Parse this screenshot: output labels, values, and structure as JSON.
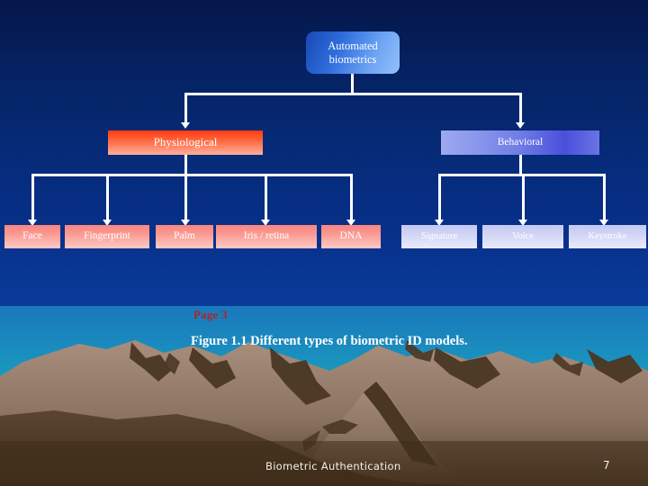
{
  "slide": {
    "root": {
      "label": "Automated\nbiometrics"
    },
    "categories": [
      {
        "label": "Physiological",
        "color": "#ff5a2e"
      },
      {
        "label": "Behavioral",
        "color": "#6f7ce6"
      }
    ],
    "leaves_physiological": [
      {
        "label": "Face"
      },
      {
        "label": "Fingerprint"
      },
      {
        "label": "Palm"
      },
      {
        "label": "Iris / retina"
      },
      {
        "label": "DNA"
      }
    ],
    "leaves_behavioral": [
      {
        "label": "Signature"
      },
      {
        "label": "Voice"
      },
      {
        "label": "Keystroke"
      }
    ],
    "page_mark": "Page 3",
    "figure_caption": "Figure 1.1 Different types of biometric ID models."
  },
  "footer": {
    "title": "Biometric Authentication",
    "page_number": "7"
  },
  "colors": {
    "background_top": "#04164a",
    "background_bottom": "#1a77bd",
    "connector": "#ffffff",
    "page_mark": "#b22424",
    "caption": "#ffffff",
    "sky_horizon": "#2de0cf",
    "mountain_light": "#9c8170",
    "mountain_dark": "#4a3723"
  }
}
